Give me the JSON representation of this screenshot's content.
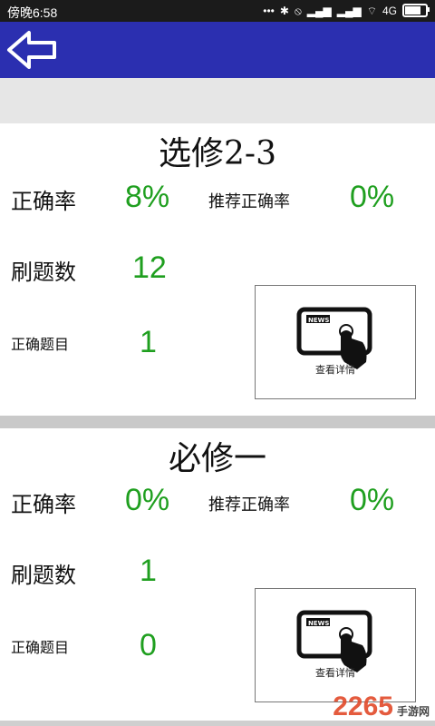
{
  "status_bar": {
    "time": "傍晚6:58",
    "network": "4G",
    "icons": [
      "dots-icon",
      "bluetooth-icon",
      "vibrate-off-icon",
      "signal-icon",
      "signal-icon",
      "wifi-icon",
      "battery-icon"
    ]
  },
  "app_bar": {
    "color": "#2b2fb0",
    "back_icon": "back-arrow-icon"
  },
  "sections": [
    {
      "title": "选修2-3",
      "accuracy_label": "正确率",
      "accuracy_value": "8%",
      "recommended_label": "推荐正确率",
      "recommended_value": "0%",
      "count_label": "刷题数",
      "count_value": "12",
      "correct_label": "正确题目",
      "correct_value": "1",
      "news_badge": "NEWS",
      "news_caption": "查看详情"
    },
    {
      "title": "必修一",
      "accuracy_label": "正确率",
      "accuracy_value": "0%",
      "recommended_label": "推荐正确率",
      "recommended_value": "0%",
      "count_label": "刷题数",
      "count_value": "1",
      "correct_label": "正确题目",
      "correct_value": "0",
      "news_badge": "NEWS",
      "news_caption": "查看详情"
    }
  ],
  "watermark": {
    "logo": "2265",
    "site": "手游网"
  },
  "colors": {
    "value_green": "#1f9f1f",
    "app_bar_blue": "#2b2fb0"
  }
}
